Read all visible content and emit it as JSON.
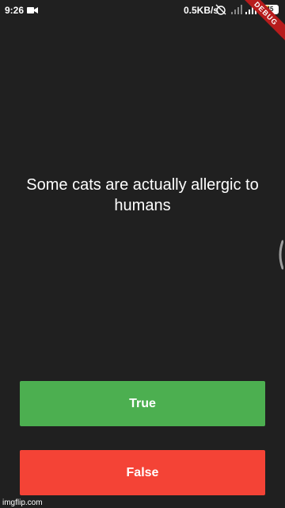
{
  "status_bar": {
    "time": "9:26",
    "net_speed": "0.5KB/s",
    "battery_level": "45",
    "icons": [
      "camera-icon",
      "alarm-off-icon",
      "signal-icon",
      "wifi-icon",
      "battery-icon"
    ]
  },
  "debug_banner": "DEBUG",
  "quiz": {
    "question": "Some cats are actually allergic to humans",
    "true_label": "True",
    "false_label": "False"
  },
  "colors": {
    "background": "#202020",
    "true_button": "#4caf50",
    "false_button": "#f44336",
    "debug_banner": "#b71c1c"
  },
  "watermark": "imgflip.com"
}
